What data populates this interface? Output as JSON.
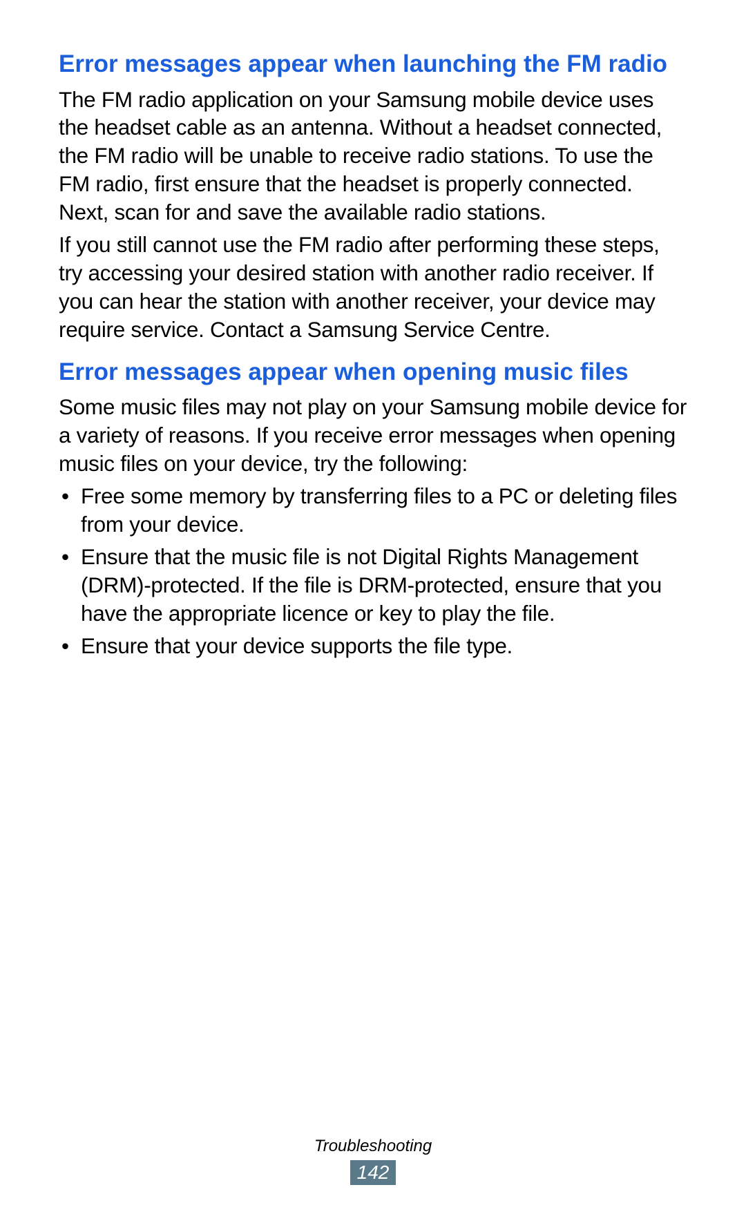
{
  "sections": [
    {
      "heading": "Error messages appear when launching the FM radio",
      "paragraphs": [
        "The FM radio application on your Samsung mobile device uses the headset cable as an antenna. Without a headset connected, the FM radio will be unable to receive radio stations. To use the FM radio, first ensure that the headset is properly connected. Next, scan for and save the available radio stations.",
        "If you still cannot use the FM radio after performing these steps, try accessing your desired station with another radio receiver. If you can hear the station with another receiver, your device may require service. Contact a Samsung Service Centre."
      ],
      "bullets": []
    },
    {
      "heading": "Error messages appear when opening music files",
      "paragraphs": [
        "Some music files may not play on your Samsung mobile device for a variety of reasons. If you receive error messages when opening music files on your device, try the following:"
      ],
      "bullets": [
        "Free some memory by transferring files to a PC or deleting files from your device.",
        "Ensure that the music file is not Digital Rights Management (DRM)-protected. If the file is DRM-protected, ensure that you have the appropriate licence or key to play the file.",
        "Ensure that your device supports the file type."
      ]
    }
  ],
  "footer": {
    "section_name": "Troubleshooting",
    "page_number": "142"
  }
}
